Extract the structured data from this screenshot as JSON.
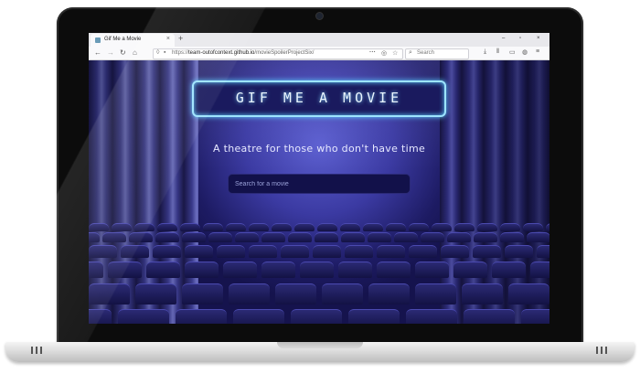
{
  "browser": {
    "tab_title": "Gif Me a Movie",
    "new_tab": "+",
    "close": "×",
    "url_prefix": "https://",
    "url_domain": "team-outofcontext.github.io",
    "url_path": "/movieSpoilerProjectSix/",
    "search_placeholder": "Search",
    "window_controls": [
      "–",
      "▫",
      "×"
    ],
    "nav_icons": [
      "back-icon",
      "forward-icon",
      "reload-icon",
      "home-icon"
    ]
  },
  "page": {
    "logo": "GIF ME A MOVIE",
    "tagline": "A theatre for those who don't have time",
    "search_placeholder": "Search for a movie"
  },
  "colors": {
    "neon": "#9de4ff",
    "background": "#1d1b63",
    "stage_light": "#5c5fd0"
  }
}
